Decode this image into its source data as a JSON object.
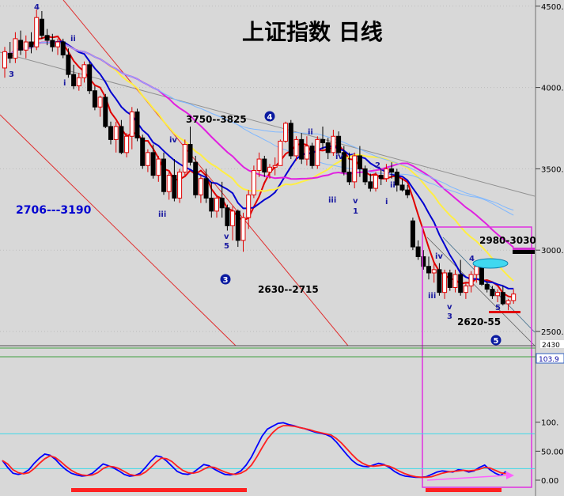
{
  "chart_data": [
    {
      "type": "candlestick",
      "title": "上证指数  日线",
      "price_axis": {
        "ylim": [
          2400,
          4500
        ],
        "ticks": [
          "4500.",
          "4000.",
          "3500.",
          "3000.",
          "2500."
        ],
        "extra_labels": [
          "2430",
          "103.9"
        ]
      },
      "colors": {
        "up": "#e00000",
        "down": "#000000",
        "ma_red": "#e00000",
        "ma_blue": "#0000d0",
        "ma_yellow": "#ffee44",
        "ma_magenta": "#e020e0",
        "ma_lightblue": "#80b8ff",
        "box": "#e030e0",
        "ellipse": "#40d8f0"
      },
      "candles": [
        [
          4120,
          4250,
          4060,
          4220
        ],
        [
          4210,
          4280,
          4150,
          4180
        ],
        [
          4180,
          4340,
          4150,
          4300
        ],
        [
          4290,
          4350,
          4200,
          4230
        ],
        [
          4230,
          4320,
          4180,
          4280
        ],
        [
          4280,
          4340,
          4210,
          4250
        ],
        [
          4250,
          4480,
          4230,
          4430
        ],
        [
          4420,
          4470,
          4300,
          4320
        ],
        [
          4320,
          4360,
          4260,
          4290
        ],
        [
          4290,
          4330,
          4220,
          4250
        ],
        [
          4250,
          4300,
          4200,
          4280
        ],
        [
          4280,
          4300,
          4180,
          4200
        ],
        [
          4200,
          4240,
          4060,
          4080
        ],
        [
          4080,
          4140,
          3990,
          4010
        ],
        [
          4010,
          4090,
          3980,
          4060
        ],
        [
          4060,
          4160,
          4030,
          4140
        ],
        [
          4140,
          4160,
          3960,
          3980
        ],
        [
          3980,
          4010,
          3860,
          3880
        ],
        [
          3880,
          3950,
          3820,
          3940
        ],
        [
          3940,
          3960,
          3750,
          3760
        ],
        [
          3760,
          3790,
          3650,
          3680
        ],
        [
          3680,
          3790,
          3600,
          3760
        ],
        [
          3760,
          3800,
          3590,
          3600
        ],
        [
          3600,
          3720,
          3570,
          3700
        ],
        [
          3700,
          3880,
          3620,
          3850
        ],
        [
          3850,
          3870,
          3670,
          3690
        ],
        [
          3690,
          3710,
          3500,
          3520
        ],
        [
          3520,
          3620,
          3480,
          3600
        ],
        [
          3600,
          3650,
          3440,
          3460
        ],
        [
          3460,
          3580,
          3420,
          3560
        ],
        [
          3560,
          3600,
          3340,
          3360
        ],
        [
          3360,
          3480,
          3310,
          3460
        ],
        [
          3460,
          3560,
          3300,
          3320
        ],
        [
          3320,
          3500,
          3290,
          3480
        ],
        [
          3480,
          3680,
          3450,
          3650
        ],
        [
          3650,
          3760,
          3520,
          3540
        ],
        [
          3540,
          3580,
          3320,
          3340
        ],
        [
          3340,
          3460,
          3290,
          3440
        ],
        [
          3440,
          3500,
          3290,
          3320
        ],
        [
          3320,
          3420,
          3200,
          3240
        ],
        [
          3240,
          3340,
          3200,
          3320
        ],
        [
          3320,
          3420,
          3200,
          3260
        ],
        [
          3260,
          3280,
          3120,
          3150
        ],
        [
          3150,
          3270,
          3060,
          3240
        ],
        [
          3240,
          3250,
          3020,
          3060
        ],
        [
          3060,
          3230,
          2990,
          3200
        ],
        [
          3200,
          3370,
          3130,
          3340
        ],
        [
          3340,
          3520,
          3320,
          3490
        ],
        [
          3490,
          3600,
          3450,
          3560
        ],
        [
          3560,
          3580,
          3450,
          3480
        ],
        [
          3480,
          3530,
          3440,
          3510
        ],
        [
          3510,
          3570,
          3460,
          3520
        ],
        [
          3520,
          3680,
          3520,
          3670
        ],
        [
          3670,
          3790,
          3660,
          3780
        ],
        [
          3780,
          3800,
          3560,
          3580
        ],
        [
          3580,
          3700,
          3550,
          3680
        ],
        [
          3680,
          3720,
          3530,
          3560
        ],
        [
          3560,
          3700,
          3520,
          3640
        ],
        [
          3640,
          3660,
          3500,
          3520
        ],
        [
          3520,
          3700,
          3500,
          3680
        ],
        [
          3680,
          3760,
          3620,
          3660
        ],
        [
          3660,
          3690,
          3560,
          3600
        ],
        [
          3600,
          3740,
          3580,
          3700
        ],
        [
          3700,
          3730,
          3580,
          3600
        ],
        [
          3600,
          3640,
          3460,
          3480
        ],
        [
          3480,
          3600,
          3400,
          3420
        ],
        [
          3420,
          3600,
          3380,
          3580
        ],
        [
          3580,
          3640,
          3450,
          3500
        ],
        [
          3500,
          3520,
          3400,
          3420
        ],
        [
          3420,
          3470,
          3360,
          3380
        ],
        [
          3380,
          3480,
          3360,
          3460
        ],
        [
          3460,
          3500,
          3400,
          3440
        ],
        [
          3440,
          3530,
          3420,
          3500
        ],
        [
          3500,
          3540,
          3440,
          3480
        ],
        [
          3480,
          3500,
          3360,
          3400
        ],
        [
          3400,
          3440,
          3360,
          3370
        ],
        [
          3370,
          3400,
          3320,
          3340
        ],
        [
          3180,
          3200,
          3000,
          3020
        ],
        [
          3020,
          3060,
          2940,
          2960
        ],
        [
          2960,
          3000,
          2880,
          2900
        ],
        [
          2900,
          2960,
          2820,
          2860
        ],
        [
          2860,
          2920,
          2800,
          2880
        ],
        [
          2880,
          2920,
          2720,
          2740
        ],
        [
          2740,
          2880,
          2700,
          2860
        ],
        [
          2860,
          2880,
          2750,
          2770
        ],
        [
          2770,
          2880,
          2740,
          2850
        ],
        [
          2850,
          2940,
          2720,
          2740
        ],
        [
          2740,
          2800,
          2700,
          2780
        ],
        [
          2780,
          2870,
          2740,
          2850
        ],
        [
          2850,
          2920,
          2800,
          2900
        ],
        [
          2900,
          2920,
          2780,
          2790
        ],
        [
          2790,
          2810,
          2740,
          2760
        ],
        [
          2760,
          2780,
          2700,
          2720
        ],
        [
          2720,
          2760,
          2680,
          2740
        ],
        [
          2740,
          2780,
          2660,
          2670
        ],
        [
          2670,
          2700,
          2630,
          2690
        ],
        [
          2690,
          2760,
          2670,
          2730
        ]
      ],
      "annotations": [
        {
          "text": "4",
          "style": "wave"
        },
        {
          "text": "ii",
          "style": "wave"
        },
        {
          "text": "i",
          "style": "wave"
        },
        {
          "text": "3",
          "style": "wave"
        },
        {
          "text": "iv",
          "style": "wave"
        },
        {
          "text": "iii",
          "style": "wave"
        },
        {
          "text": "v",
          "style": "wave"
        },
        {
          "text": "5",
          "style": "wave"
        },
        {
          "text": "3",
          "style": "circle"
        },
        {
          "text": "4",
          "style": "circle"
        },
        {
          "text": "ii",
          "style": "wave"
        },
        {
          "text": "iv",
          "style": "wave"
        },
        {
          "text": "iii",
          "style": "wave"
        },
        {
          "text": "v",
          "style": "wave"
        },
        {
          "text": "1",
          "style": "wave"
        },
        {
          "text": "2",
          "style": "wave"
        },
        {
          "text": "i",
          "style": "wave"
        },
        {
          "text": "ii",
          "style": "wave"
        },
        {
          "text": "iv",
          "style": "wave"
        },
        {
          "text": "iii",
          "style": "wave"
        },
        {
          "text": "v",
          "style": "wave"
        },
        {
          "text": "3",
          "style": "wave"
        },
        {
          "text": "4",
          "style": "wave"
        },
        {
          "text": "5",
          "style": "wave"
        },
        {
          "text": "5",
          "style": "circle"
        }
      ],
      "labels": [
        {
          "text": "3750--3825",
          "style": "bold"
        },
        {
          "text": "2706---3190",
          "style": "blue"
        },
        {
          "text": "2630--2715",
          "style": "bold"
        },
        {
          "text": "2980-3030",
          "style": "bold"
        },
        {
          "text": "2620-55",
          "style": "bold"
        }
      ]
    },
    {
      "type": "line",
      "ylim": [
        0,
        130
      ],
      "ticks": [
        "100.",
        "50.00",
        "0.00"
      ],
      "reference_lines": [
        80,
        20
      ],
      "series": [
        {
          "color": "#0000ff",
          "values": [
            34,
            22,
            12,
            10,
            12,
            18,
            29,
            38,
            45,
            43,
            36,
            26,
            18,
            12,
            9,
            7,
            8,
            12,
            20,
            28,
            25,
            21,
            16,
            10,
            7,
            8,
            12,
            22,
            33,
            42,
            40,
            33,
            24,
            15,
            11,
            10,
            13,
            20,
            27,
            25,
            19,
            14,
            10,
            9,
            11,
            16,
            26,
            40,
            58,
            76,
            88,
            93,
            98,
            99,
            96,
            94,
            91,
            89,
            86,
            83,
            81,
            79,
            75,
            66,
            55,
            44,
            34,
            27,
            24,
            23,
            26,
            29,
            27,
            22,
            15,
            10,
            7,
            6,
            5,
            5,
            6,
            10,
            14,
            16,
            15,
            14,
            18,
            17,
            14,
            16,
            22,
            26,
            18,
            12,
            8,
            15
          ]
        },
        {
          "color": "#ff2020",
          "values": [
            34,
            28,
            18,
            13,
            11,
            13,
            20,
            29,
            37,
            42,
            39,
            32,
            24,
            17,
            12,
            9,
            8,
            9,
            13,
            20,
            24,
            23,
            20,
            15,
            10,
            8,
            9,
            14,
            22,
            31,
            38,
            37,
            32,
            24,
            17,
            13,
            12,
            14,
            19,
            23,
            22,
            18,
            14,
            11,
            10,
            12,
            17,
            26,
            40,
            56,
            71,
            82,
            90,
            94,
            94,
            93,
            91,
            89,
            87,
            84,
            82,
            80,
            78,
            72,
            64,
            54,
            44,
            35,
            29,
            25,
            24,
            25,
            26,
            24,
            20,
            15,
            11,
            8,
            6,
            5,
            5,
            6,
            9,
            12,
            14,
            15,
            16,
            17,
            16,
            17,
            19,
            22,
            21,
            17,
            13,
            11
          ]
        }
      ]
    }
  ]
}
